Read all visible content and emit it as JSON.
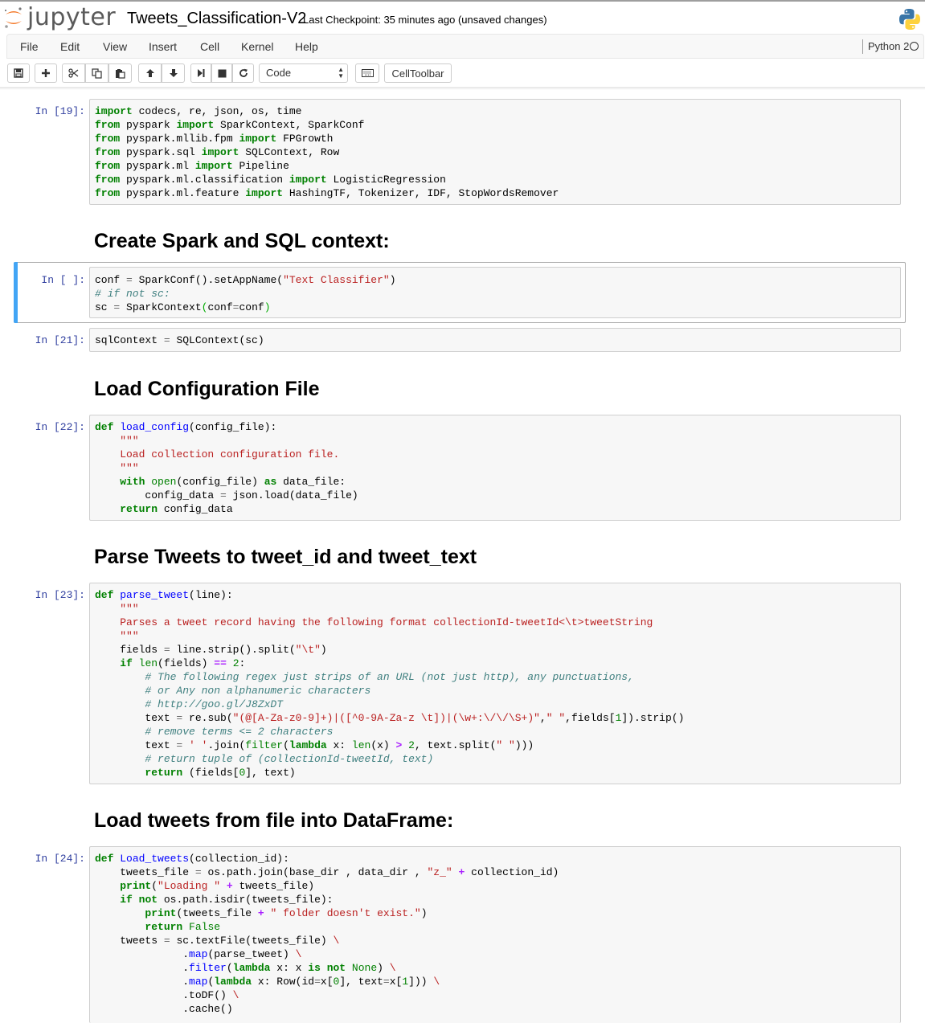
{
  "app": {
    "logo_text": "jupyter",
    "notebook_title": "Tweets_Classification-V2",
    "checkpoint": "Last Checkpoint: 35 minutes ago (unsaved changes)"
  },
  "menu": {
    "items": [
      "File",
      "Edit",
      "View",
      "Insert",
      "Cell",
      "Kernel",
      "Help"
    ],
    "kernel": "Python 2"
  },
  "toolbar": {
    "cell_type": "Code",
    "celltoolbar_label": "CellToolbar",
    "icons": [
      "save-icon",
      "plus-icon",
      "cut-icon",
      "copy-icon",
      "paste-icon",
      "arrow-up-icon",
      "arrow-down-icon",
      "step-forward-icon",
      "stop-icon",
      "refresh-icon",
      "keyboard-icon"
    ]
  },
  "colors": {
    "prompt": "#303f9f",
    "selected_bar": "#42a5f5",
    "keyword": "#008000",
    "string": "#ba2121",
    "comment": "#408080",
    "function": "#0000ff"
  },
  "cells": [
    {
      "prompt": "In [19]:",
      "lines": [
        "import codecs, re, json, os, time",
        "from pyspark import SparkContext, SparkConf",
        "from pyspark.mllib.fpm import FPGrowth",
        "from pyspark.sql import SQLContext, Row",
        "from pyspark.ml import Pipeline",
        "from pyspark.ml.classification import LogisticRegression",
        "from pyspark.ml.feature import HashingTF, Tokenizer, IDF, StopWordsRemover"
      ]
    },
    {
      "heading": "Create Spark and SQL context:"
    },
    {
      "prompt": "In [ ]:",
      "lines": [
        "conf = SparkConf().setAppName(\"Text Classifier\")",
        "# if not sc:",
        "sc = SparkContext(conf=conf)"
      ]
    },
    {
      "prompt": "In [21]:",
      "lines": [
        "sqlContext = SQLContext(sc)"
      ]
    },
    {
      "heading": "Load Configuration File"
    },
    {
      "prompt": "In [22]:",
      "lines": [
        "def load_config(config_file):",
        "    \"\"\"",
        "    Load collection configuration file.",
        "    \"\"\"",
        "    with open(config_file) as data_file:",
        "        config_data = json.load(data_file)",
        "    return config_data"
      ]
    },
    {
      "heading": "Parse Tweets to tweet_id and tweet_text"
    },
    {
      "prompt": "In [23]:",
      "lines": [
        "def parse_tweet(line):",
        "    \"\"\"",
        "    Parses a tweet record having the following format collectionId-tweetId<\\t>tweetString",
        "    \"\"\"",
        "    fields = line.strip().split(\"\\t\")",
        "    if len(fields) == 2:",
        "        # The following regex just strips of an URL (not just http), any punctuations,",
        "        # or Any non alphanumeric characters",
        "        # http://goo.gl/J8ZxDT",
        "        text = re.sub(\"(@[A-Za-z0-9]+)|([^0-9A-Za-z \\t])|(\\w+:\\/\\/\\S+)\",\" \",fields[1]).strip()",
        "        # remove terms <= 2 characters",
        "        text = ' '.join(filter(lambda x: len(x) > 2, text.split(\" \")))",
        "        # return tuple of (collectionId-tweetId, text)",
        "        return (fields[0], text)"
      ]
    },
    {
      "heading": "Load tweets from file into DataFrame:"
    },
    {
      "prompt": "In [24]:",
      "lines": [
        "def Load_tweets(collection_id):",
        "    tweets_file = os.path.join(base_dir , data_dir , \"z_\" + collection_id)",
        "    print(\"Loading \" + tweets_file)",
        "    if not os.path.isdir(tweets_file):",
        "        print(tweets_file + \" folder doesn't exist.\")",
        "        return False",
        "    tweets = sc.textFile(tweets_file) \\",
        "              .map(parse_tweet) \\",
        "              .filter(lambda x: x is not None) \\",
        "              .map(lambda x: Row(id=x[0], text=x[1])) \\",
        "              .toDF() \\",
        "              .cache()"
      ]
    }
  ]
}
